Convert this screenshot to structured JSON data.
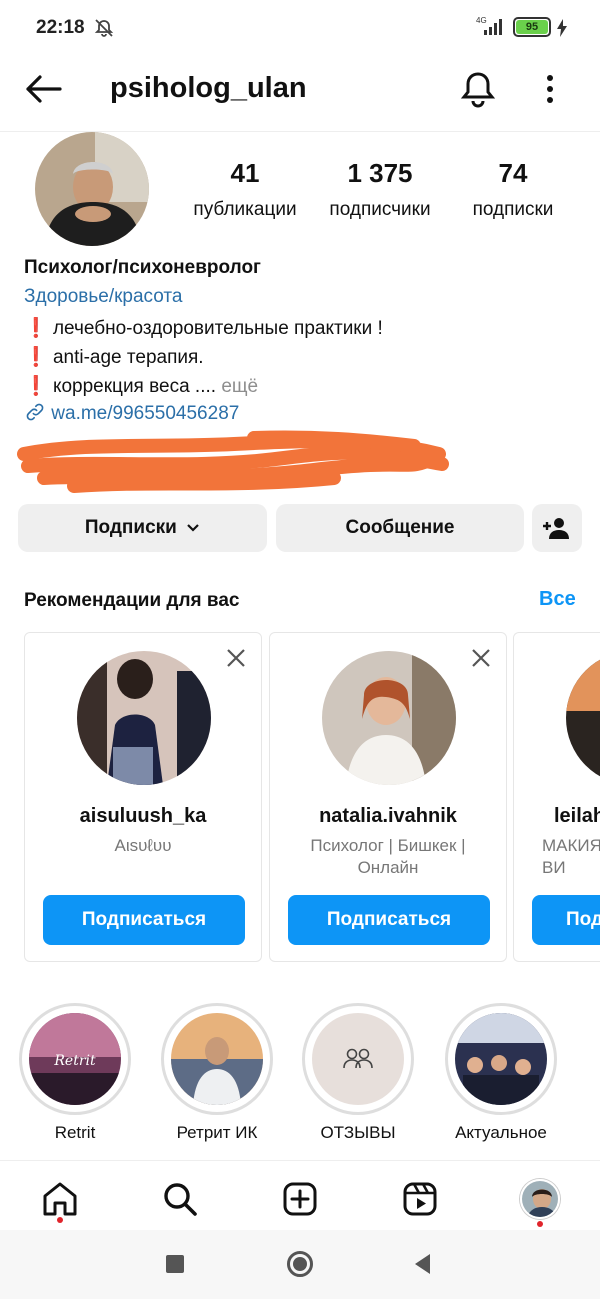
{
  "status": {
    "time": "22:18",
    "network": "4G",
    "battery": "95"
  },
  "header": {
    "username": "psiholog_ulan"
  },
  "stats": [
    {
      "value": "41",
      "label": "публикации"
    },
    {
      "value": "1 375",
      "label": "подписчики"
    },
    {
      "value": "74",
      "label": "подписки"
    }
  ],
  "bio": {
    "title": "Психолог/психоневролог",
    "category": "Здоровье/красота",
    "line1": "лечебно-оздоровительные практики !",
    "line2": "anti-age терапия.",
    "line3": "коррекция веса ....",
    "more": "ещё",
    "link": "wa.me/996550456287",
    "exclamation": "❗"
  },
  "actions": {
    "following": "Подписки",
    "message": "Сообщение"
  },
  "suggestions": {
    "title": "Рекомендации для вас",
    "see_all": "Все",
    "cards": [
      {
        "username": "aisuluush_ka",
        "name": "Aιsυℓυυ",
        "button": "Подписаться"
      },
      {
        "username": "natalia.ivahnik",
        "name": "Психолог | Бишкек | Онлайн",
        "button": "Подписаться"
      },
      {
        "username": "leilah",
        "name": "МАКИЯ ВИ",
        "button": "Под"
      }
    ]
  },
  "highlights": [
    {
      "label": "Retrit",
      "cover_text": "Retrit"
    },
    {
      "label": "Ретрит ИК"
    },
    {
      "label": "ОТЗЫВЫ"
    },
    {
      "label": "Актуальное"
    }
  ],
  "colors": {
    "accent": "#0d95f6",
    "link": "#2b6fa8",
    "redact": "#f2743a"
  }
}
